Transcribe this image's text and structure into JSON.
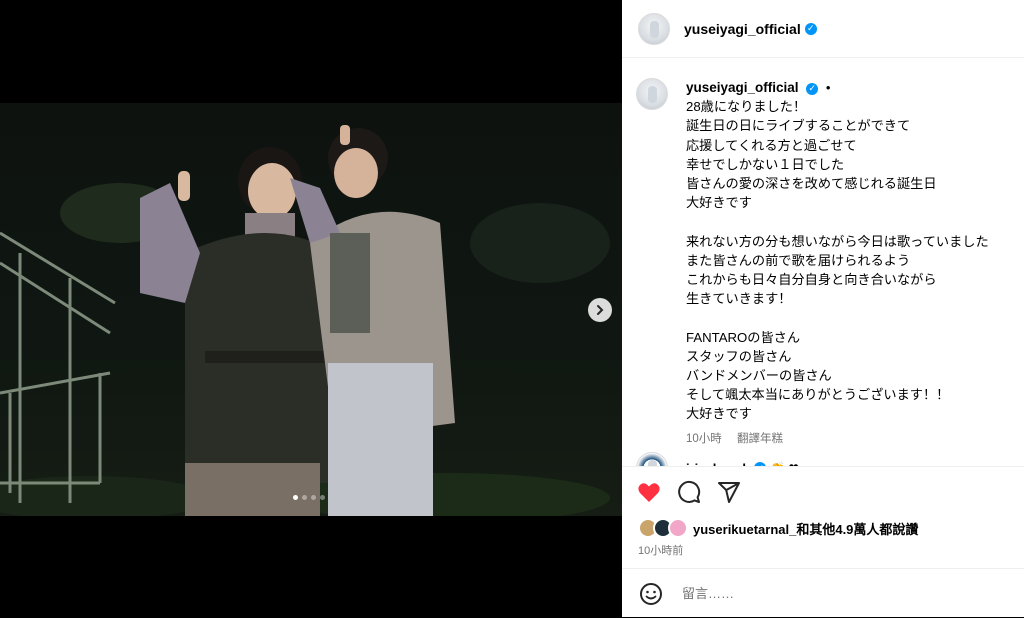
{
  "post": {
    "username": "yuseiyagi_official",
    "caption_username": "yuseiyagi_official",
    "caption_dot": "•",
    "caption_lines": [
      "28歳になりました！",
      "誕生日の日にライブすることができて",
      "応援してくれる方と過ごせて",
      "幸せでしかない１日でした",
      "皆さんの愛の深さを改めて感じれる誕生日",
      "大好きです",
      "",
      "来れない方の分も想いながら今日は歌っていました",
      "また皆さんの前で歌を届けられるよう",
      "これからも日々自分自身と向き合いながら",
      "生きていきます！",
      "",
      "FANTAROの皆さん",
      "スタッフの皆さん",
      "バンドメンバーの皆さん",
      "そして颯太本当にありがとうございます！！",
      "大好きです"
    ],
    "caption_time": "10小時",
    "translate_label": "翻譯年糕",
    "next_comment_user": "iris_beach",
    "next_comment_emoji": "👏 ❤",
    "likes_text": "yuserikuetarnal_和其他4.9萬人都說讚",
    "post_time": "10小時前",
    "comment_placeholder": "留言……",
    "carousel_total": 4,
    "carousel_active": 1
  },
  "icons": {
    "verified": "verified-badge-icon",
    "heart": "heart-icon",
    "comment": "comment-icon",
    "share": "share-icon",
    "next": "chevron-right-icon",
    "emoji": "emoji-smile-icon"
  },
  "colors": {
    "heart": "#ff3040",
    "verified": "#0095f6",
    "muted": "#737373"
  }
}
